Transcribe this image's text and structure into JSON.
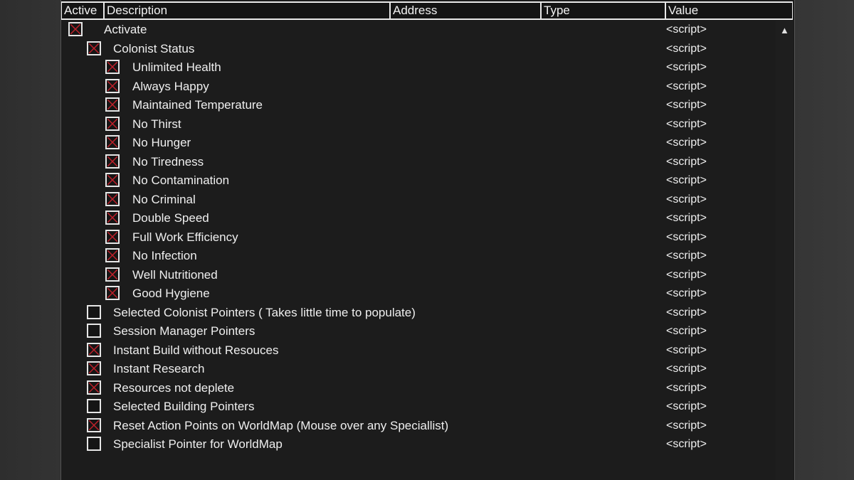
{
  "columns": [
    "Active",
    "Description",
    "Address",
    "Type",
    "Value"
  ],
  "colors": {
    "check_mark": "#c0202a",
    "border": "#e6e6e6",
    "background": "#1c1c1c"
  },
  "rows": [
    {
      "label": "Activate",
      "value": "<script>",
      "checked": true,
      "level": 0
    },
    {
      "label": "Colonist Status",
      "value": "<script>",
      "checked": true,
      "level": 1
    },
    {
      "label": "Unlimited Health",
      "value": "<script>",
      "checked": true,
      "level": 2
    },
    {
      "label": "Always Happy",
      "value": "<script>",
      "checked": true,
      "level": 2
    },
    {
      "label": "Maintained Temperature",
      "value": "<script>",
      "checked": true,
      "level": 2
    },
    {
      "label": "No Thirst",
      "value": "<script>",
      "checked": true,
      "level": 2
    },
    {
      "label": "No Hunger",
      "value": "<script>",
      "checked": true,
      "level": 2
    },
    {
      "label": "No Tiredness",
      "value": "<script>",
      "checked": true,
      "level": 2
    },
    {
      "label": "No Contamination",
      "value": "<script>",
      "checked": true,
      "level": 2
    },
    {
      "label": "No Criminal",
      "value": "<script>",
      "checked": true,
      "level": 2
    },
    {
      "label": "Double Speed",
      "value": "<script>",
      "checked": true,
      "level": 2
    },
    {
      "label": "Full Work Efficiency",
      "value": "<script>",
      "checked": true,
      "level": 2
    },
    {
      "label": "No Infection",
      "value": "<script>",
      "checked": true,
      "level": 2
    },
    {
      "label": "Well Nutritioned",
      "value": "<script>",
      "checked": true,
      "level": 2
    },
    {
      "label": "Good Hygiene",
      "value": "<script>",
      "checked": true,
      "level": 2
    },
    {
      "label": "Selected Colonist Pointers ( Takes little time to populate)",
      "value": "<script>",
      "checked": false,
      "level": 1
    },
    {
      "label": "Session Manager Pointers",
      "value": "<script>",
      "checked": false,
      "level": 1
    },
    {
      "label": "Instant Build without Resouces",
      "value": "<script>",
      "checked": true,
      "level": 1
    },
    {
      "label": "Instant Research",
      "value": "<script>",
      "checked": true,
      "level": 1
    },
    {
      "label": "Resources not deplete",
      "value": "<script>",
      "checked": true,
      "level": 1
    },
    {
      "label": "Selected Building Pointers",
      "value": "<script>",
      "checked": false,
      "level": 1
    },
    {
      "label": "Reset Action Points on WorldMap (Mouse over any Speciallist)",
      "value": "<script>",
      "checked": true,
      "level": 1
    },
    {
      "label": "Specialist Pointer for WorldMap",
      "value": "<script>",
      "checked": false,
      "level": 1
    }
  ],
  "scrollbar": {
    "up_icon": "chevron-up-icon"
  }
}
